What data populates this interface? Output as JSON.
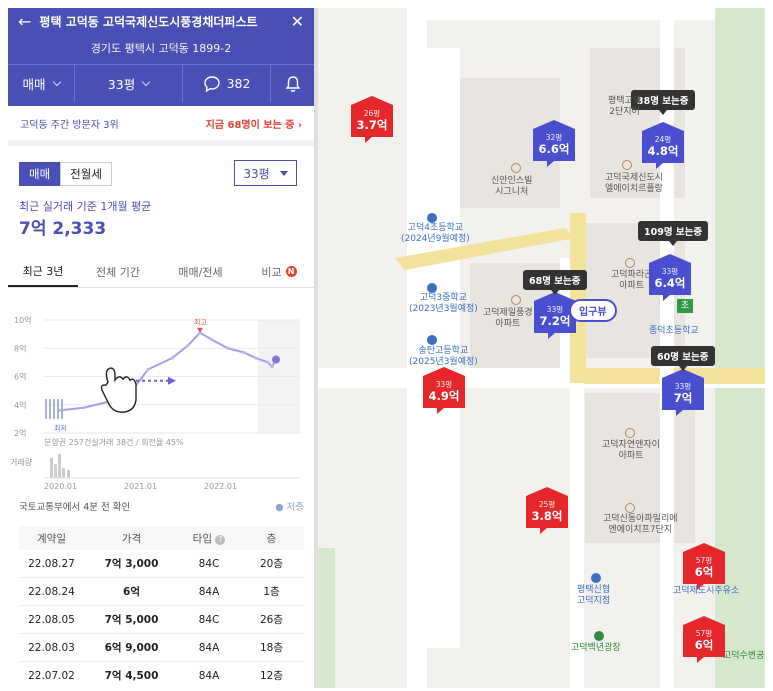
{
  "header": {
    "back_icon": "←",
    "title": "평택 고덕동 고덕국제신도시풍경채더퍼스트",
    "close_icon": "✕",
    "address": "경기도 평택시 고덕동 1899-2",
    "deal_type": "매매",
    "pyeong": "33평",
    "comment_count": "382"
  },
  "visit": {
    "rank_text": "고덕동 주간 방문자 3위",
    "now_viewing": "지금 68명이 보는 중 ›"
  },
  "segments": {
    "sale": "매매",
    "rent": "전월세"
  },
  "pyeong_select": "33평",
  "recent": {
    "label": "최근 실거래 기준 1개월 평균",
    "price": "7억 2,333"
  },
  "period_tabs": [
    {
      "label": "최근 3년"
    },
    {
      "label": "전체 기간"
    },
    {
      "label": "매매/전세"
    },
    {
      "label": "비교",
      "badge": "N"
    }
  ],
  "chart_data": {
    "type": "line",
    "y_ticks": [
      "10억",
      "8억",
      "6억",
      "4억",
      "2억"
    ],
    "ylim": [
      2,
      10
    ],
    "x_ticks": [
      "2020.01",
      "2021.01",
      "2022.01"
    ],
    "max_label": "최고",
    "min_label": "최저",
    "series": [
      {
        "values": [
          [
            2020.0,
            3.6
          ],
          [
            2020.3,
            3.8
          ],
          [
            2020.6,
            4.2
          ],
          [
            2020.9,
            5.0
          ],
          [
            2021.1,
            6.5
          ],
          [
            2021.4,
            7.3
          ],
          [
            2021.6,
            8.2
          ],
          [
            2021.75,
            9.1
          ],
          [
            2021.9,
            8.6
          ],
          [
            2022.1,
            8.0
          ],
          [
            2022.3,
            7.7
          ],
          [
            2022.45,
            7.3
          ],
          [
            2022.6,
            7.0
          ],
          [
            2022.65,
            6.7
          ],
          [
            2022.7,
            7.2
          ]
        ]
      }
    ],
    "caption": "분양권 257건실거래 38건 / 회전율 45%",
    "volume_label": "거래량"
  },
  "mlit": {
    "label": "국토교통부에서 4분 전 확인",
    "legend": "저층"
  },
  "table": {
    "headers": [
      "계약일",
      "가격",
      "타입",
      "층"
    ],
    "rows": [
      [
        "22.08.27",
        "7억 3,000",
        "84C",
        "20층"
      ],
      [
        "22.08.24",
        "6억",
        "84A",
        "1층"
      ],
      [
        "22.08.05",
        "7억 5,000",
        "84C",
        "26층"
      ],
      [
        "22.08.03",
        "6억 9,000",
        "84A",
        "18층"
      ],
      [
        "22.07.02",
        "7억 4,500",
        "84A",
        "12층"
      ]
    ]
  },
  "map": {
    "pins": [
      {
        "color": "red",
        "py": "26평",
        "price": "3.7억"
      },
      {
        "color": "blue",
        "py": "32평",
        "price": "6.6억"
      },
      {
        "color": "blue",
        "py": "24평",
        "price": "4.8억"
      },
      {
        "color": "blue",
        "py": "33평",
        "price": "6.4억"
      },
      {
        "color": "blue",
        "py": "33평",
        "price": "7.2억"
      },
      {
        "color": "red",
        "py": "33평",
        "price": "4.9억"
      },
      {
        "color": "blue",
        "py": "33평",
        "price": "7억"
      },
      {
        "color": "red",
        "py": "25평",
        "price": "3.8억"
      },
      {
        "color": "red",
        "py": "57평",
        "price": "6억"
      },
      {
        "color": "red",
        "py": "57평",
        "price": "6억"
      }
    ],
    "bubbles": [
      "38명 보는중",
      "109명 보는중",
      "68명 보는중",
      "60명 보는중"
    ],
    "labels": {
      "l1": "평택고덕\n2단지어",
      "l2": "신안인스빌\n시그니처",
      "l3": "고덕국제신도시\n엘에이치르플랑",
      "l4": "고덕4초등학교\n(2024년9월예정)",
      "l5": "고덕3중학교\n(2023년3월예정)",
      "l6": "고덕제일풍경\n아파트",
      "l7": "고덕파라곤\n아파트",
      "l8": "송탄고등학교\n(2025년3월예정)",
      "l9": "종덕초등학교",
      "l10": "고덕자연앤자이\n아파트",
      "l11": "고덕신동아파밀리에\n엔에이치프7단지",
      "l12": "평택신협\n고덕지점",
      "l13": "고덕제도시주유소",
      "l14": "고덕백년광장",
      "l15": "고덕수변공원"
    },
    "roadview": "입구뷰",
    "school_badge": "초"
  }
}
